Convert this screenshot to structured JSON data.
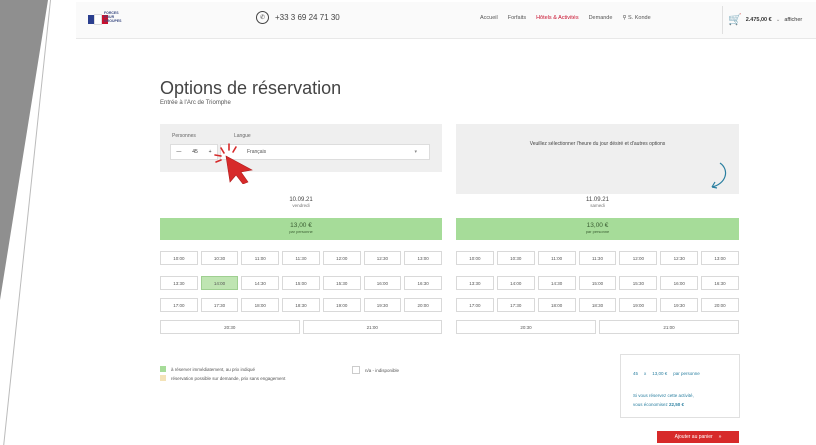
{
  "header": {
    "logo_text": "FORCES POUR GROUPES",
    "phone": "+33 3 69 24 71 30",
    "nav": [
      "Accueil",
      "Forfaits",
      "Hôtels & Activités",
      "Demande",
      "S. Konde"
    ],
    "cart_total": "2.475,00 €",
    "cart_view": "afficher"
  },
  "page": {
    "title": "Options de réservation",
    "subtitle": "Entrée à l'Arc de Triomphe"
  },
  "options": {
    "persons_label": "Personnes",
    "language_label": "Langue",
    "persons_value": "45",
    "language_value": "Français"
  },
  "info": {
    "text": "Veuillez sélectionner l'heure du jour désiré et d'autres options"
  },
  "days": [
    {
      "date": "10.09.21",
      "weekday": "vendredi",
      "price": "13,00 €",
      "price_unit": "par personne",
      "rows": [
        [
          "10:00",
          "10:30",
          "11:00",
          "11:30",
          "12:00",
          "12:30",
          "13:00"
        ],
        [
          "13:30",
          "14:00",
          "14:30",
          "15:00",
          "15:30",
          "16:00",
          "16:30"
        ],
        [
          "17:00",
          "17:30",
          "18:00",
          "18:30",
          "19:00",
          "19:30",
          "20:00"
        ],
        [
          "20:30",
          "21:00"
        ]
      ]
    },
    {
      "date": "11.09.21",
      "weekday": "samedi",
      "price": "13,00 €",
      "price_unit": "par personne",
      "rows": [
        [
          "10:00",
          "10:30",
          "11:00",
          "11:30",
          "12:00",
          "12:30",
          "13:00"
        ],
        [
          "13:30",
          "14:00",
          "14:30",
          "15:00",
          "15:30",
          "16:00",
          "16:30"
        ],
        [
          "17:00",
          "17:30",
          "18:00",
          "18:30",
          "19:00",
          "19:30",
          "20:00"
        ],
        [
          "20:30",
          "21:00"
        ]
      ]
    }
  ],
  "legend": {
    "immediate": "à réserver immédiatement, au prix indiqué",
    "on_request": "réservation possible sur demande, prix sans engagement",
    "unavailable": "n/a - indisponible"
  },
  "summary": {
    "qty": "45",
    "times": "x",
    "unit_price": "13,00 €",
    "per": "par personne",
    "note_line1": "Si vous réservez cette activité,",
    "note_line2": "vous économisez",
    "savings": "22,50 €"
  },
  "actions": {
    "add_to_cart": "Ajouter au panier"
  },
  "colors": {
    "accent_red": "#d72a2a",
    "available_green": "#a6dc99",
    "selected_green": "#bfe5b2",
    "request_yellow": "#f4e3b8",
    "link_blue": "#2a7fa0"
  }
}
